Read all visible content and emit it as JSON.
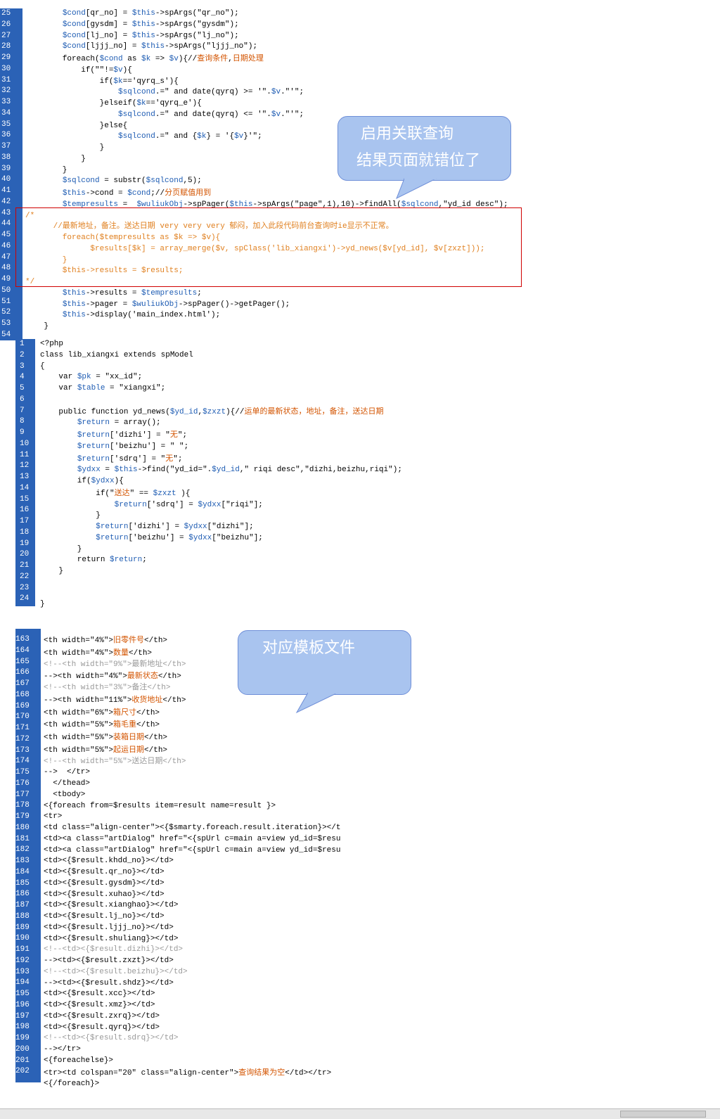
{
  "panel1": {
    "start": 25,
    "lines": [
      "        $cond[qr_no] = $this->spArgs(\"qr_no\");",
      "        $cond[gysdm] = $this->spArgs(\"gysdm\");",
      "        $cond[lj_no] = $this->spArgs(\"lj_no\");",
      "        $cond[ljjj_no] = $this->spArgs(\"ljjj_no\");",
      "        foreach($cond as $k => $v){//查询条件,日期处理",
      "            if(\"\"!=$v){",
      "                if($k=='qyrq_s'){",
      "                    $sqlcond.=\" and date(qyrq) >= '\".$v.\"'\";",
      "                }elseif($k=='qyrq_e'){",
      "                    $sqlcond.=\" and date(qyrq) <= '\".$v.\"'\";",
      "                }else{",
      "                    $sqlcond.=\" and {$k} = '{$v}'\";",
      "                }",
      "            }",
      "        }",
      "        $sqlcond = substr($sqlcond,5);",
      "        $this->cond = $cond;//分页赋值用到",
      "        $tempresults =  $wuliukObj->spPager($this->spArgs(\"page\",1),10)->findAll($sqlcond,\"yd_id desc\");",
      "/*",
      "      //最新地址，备注。送达日期 very very very 郁闷，加入此段代码前台查询时ie显示不正常。",
      "        foreach($tempresults as $k => $v){",
      "              $results[$k] = array_merge($v, spClass('lib_xiangxi')->yd_news($v[yd_id], $v[zxzt]));",
      "        }",
      "        $this->results = $results;",
      "*/",
      "        $this->results = $tempresults;",
      "        $this->pager = $wuliukObj->spPager()->getPager();",
      "        $this->display('main_index.html');",
      "    }",
      ""
    ]
  },
  "panel2": {
    "start": 1,
    "lines": [
      "<?php",
      "class lib_xiangxi extends spModel",
      "{",
      "    var $pk = \"xx_id\";",
      "    var $table = \"xiangxi\";",
      "",
      "    public function yd_news($yd_id,$zxzt){//运单的最新状态，地址，备注，送达日期",
      "        $return = array();",
      "        $return['dizhi'] = \"无\";",
      "        $return['beizhu'] = \" \";",
      "        $return['sdrq'] = \"无\";",
      "        $ydxx = $this->find(\"yd_id=\".$yd_id,\" riqi desc\",\"dizhi,beizhu,riqi\");",
      "        if($ydxx){",
      "            if(\"送达\" == $zxzt ){",
      "                $return['sdrq'] = $ydxx[\"riqi\"];",
      "            }",
      "            $return['dizhi'] = $ydxx[\"dizhi\"];",
      "            $return['beizhu'] = $ydxx[\"beizhu\"];",
      "        }",
      "        return $return;",
      "    }",
      "",
      "",
      "}"
    ]
  },
  "panel3": {
    "start": 163,
    "lines": [
      "<th width=\"4%\">旧零件号</th>",
      "<th width=\"4%\">数量</th>",
      "<!--<th width=\"9%\">最新地址</th>",
      "--><th width=\"4%\">最新状态</th>",
      "<!--<th width=\"3%\">备注</th>",
      "--><th width=\"11%\">收货地址</th>",
      "<th width=\"6%\">箱尺寸</th>",
      "<th width=\"5%\">箱毛重</th>",
      "<th width=\"5%\">装箱日期</th>",
      "<th width=\"5%\">起运日期</th>",
      "<!--<th width=\"5%\">送达日期</th>",
      "-->  </tr>",
      "  </thead>",
      "  <tbody>",
      "<{foreach from=$results item=result name=result }>",
      "<tr>",
      "<td class=\"align-center\"><{$smarty.foreach.result.iteration}></t",
      "<td><a class=\"artDialog\" href=\"<{spUrl c=main a=view yd_id=$resu",
      "<td><a class=\"artDialog\" href=\"<{spUrl c=main a=view yd_id=$resu",
      "<td><{$result.khdd_no}></td>",
      "<td><{$result.qr_no}></td>",
      "<td><{$result.gysdm}></td>",
      "<td><{$result.xuhao}></td>",
      "<td><{$result.xianghao}></td>",
      "<td><{$result.lj_no}></td>",
      "<td><{$result.ljjj_no}></td>",
      "<td><{$result.shuliang}></td>",
      "<!--<td><{$result.dizhi}></td>",
      "--><td><{$result.zxzt}></td>",
      "<!--<td><{$result.beizhu}></td>",
      "--><td><{$result.shdz}></td>",
      "<td><{$result.xcc}></td>",
      "<td><{$result.xmz}></td>",
      "<td><{$result.zxrq}></td>",
      "<td><{$result.qyrq}></td>",
      "<!--<td><{$result.sdrq}></td>",
      "--></tr>",
      "<{foreachelse}>",
      "<tr><td colspan=\"20\" class=\"align-center\">查询结果为空</td></tr>",
      "<{/foreach}>"
    ]
  },
  "bubble1": {
    "line1": "启用关联查询",
    "line2": "结果页面就错位了",
    "fill": "#a9c4ef"
  },
  "bubble2": {
    "line1": "对应模板文件",
    "fill": "#a9c4ef"
  },
  "colors": {
    "gutter": "#2b62b6",
    "annotation_box": "#d00000"
  }
}
